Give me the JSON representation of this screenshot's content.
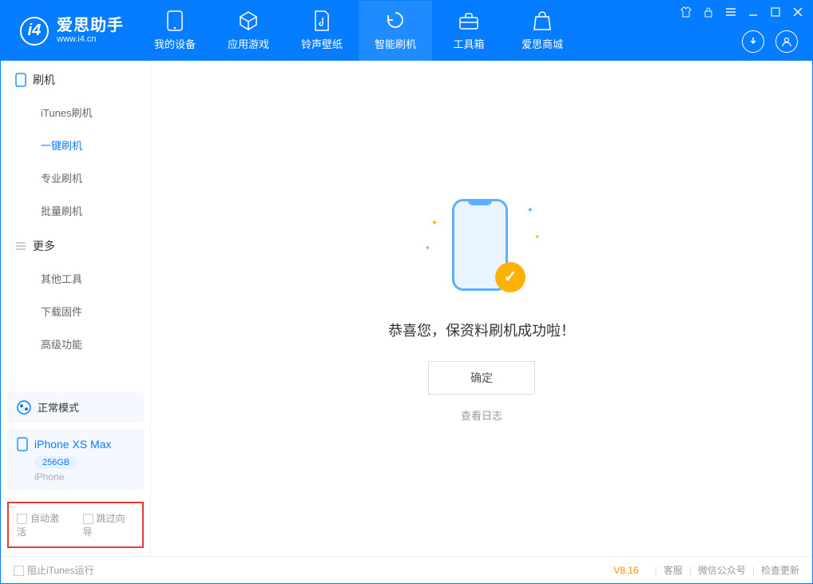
{
  "app": {
    "title": "爱思助手",
    "subtitle": "www.i4.cn"
  },
  "tabs": {
    "device": "我的设备",
    "apps": "应用游戏",
    "ringtones": "铃声壁纸",
    "flash": "智能刷机",
    "toolbox": "工具箱",
    "store": "爱思商城"
  },
  "sidebar": {
    "section_flash": "刷机",
    "items_flash": {
      "itunes": "iTunes刷机",
      "oneclick": "一键刷机",
      "pro": "专业刷机",
      "batch": "批量刷机"
    },
    "section_more": "更多",
    "items_more": {
      "other": "其他工具",
      "firmware": "下载固件",
      "advanced": "高级功能"
    },
    "mode": "正常模式",
    "device_name": "iPhone XS Max",
    "capacity": "256GB",
    "device_type": "iPhone",
    "auto_activate": "自动激活",
    "skip_guide": "跳过向导"
  },
  "main": {
    "success_text": "恭喜您，保资料刷机成功啦！",
    "ok": "确定",
    "view_log": "查看日志"
  },
  "statusbar": {
    "block_itunes": "阻止iTunes运行",
    "version": "V8.16",
    "support": "客服",
    "wechat": "微信公众号",
    "check_update": "检查更新"
  }
}
